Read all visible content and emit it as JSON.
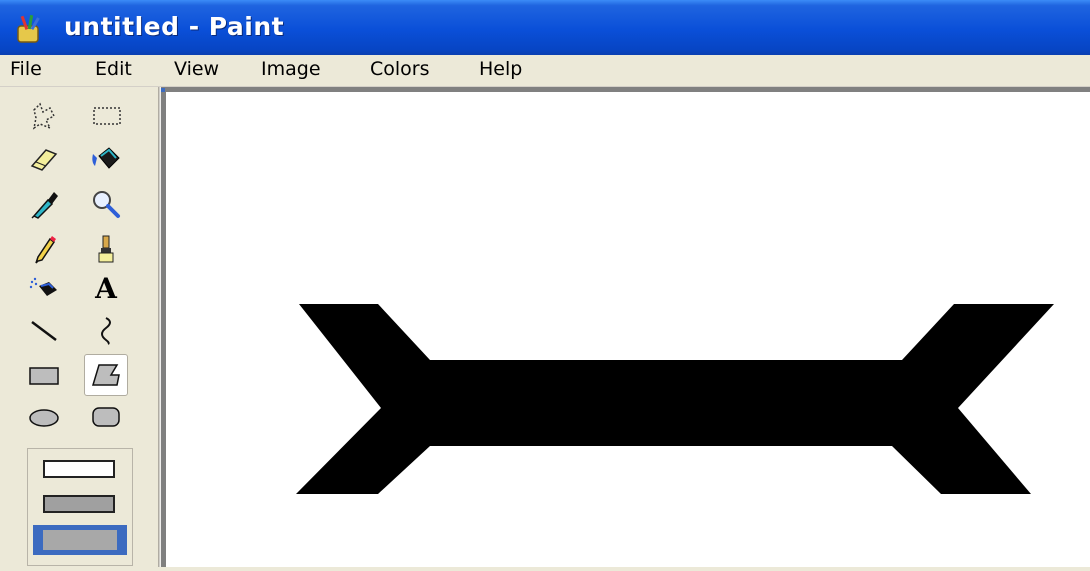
{
  "window": {
    "title": "untitled - Paint",
    "title_bar_color": "#0a4fd8"
  },
  "menu": {
    "items": [
      {
        "label": "File"
      },
      {
        "label": "Edit"
      },
      {
        "label": "View"
      },
      {
        "label": "Image"
      },
      {
        "label": "Colors"
      },
      {
        "label": "Help"
      }
    ]
  },
  "toolbox": {
    "tools": [
      {
        "name": "free-form-select",
        "icon": "free-form-select-icon"
      },
      {
        "name": "select",
        "icon": "rectangle-select-icon"
      },
      {
        "name": "eraser",
        "icon": "eraser-icon"
      },
      {
        "name": "fill-with-color",
        "icon": "paint-bucket-icon"
      },
      {
        "name": "pick-color",
        "icon": "eyedropper-icon"
      },
      {
        "name": "magnifier",
        "icon": "magnifier-icon"
      },
      {
        "name": "pencil",
        "icon": "pencil-icon"
      },
      {
        "name": "brush",
        "icon": "brush-icon"
      },
      {
        "name": "airbrush",
        "icon": "airbrush-icon"
      },
      {
        "name": "text",
        "icon": "text-icon",
        "glyph": "A"
      },
      {
        "name": "line",
        "icon": "line-icon"
      },
      {
        "name": "curve",
        "icon": "curve-icon"
      },
      {
        "name": "rectangle",
        "icon": "rectangle-icon"
      },
      {
        "name": "polygon",
        "icon": "polygon-icon",
        "selected": true
      },
      {
        "name": "ellipse",
        "icon": "ellipse-icon"
      },
      {
        "name": "rounded-rectangle",
        "icon": "rounded-rectangle-icon"
      }
    ],
    "fill_options": [
      {
        "name": "outline"
      },
      {
        "name": "outline-and-fill"
      },
      {
        "name": "fill-only",
        "selected": true
      }
    ]
  },
  "canvas": {
    "background": "#ffffff",
    "shape_color": "#000000",
    "shape": "polygon"
  }
}
